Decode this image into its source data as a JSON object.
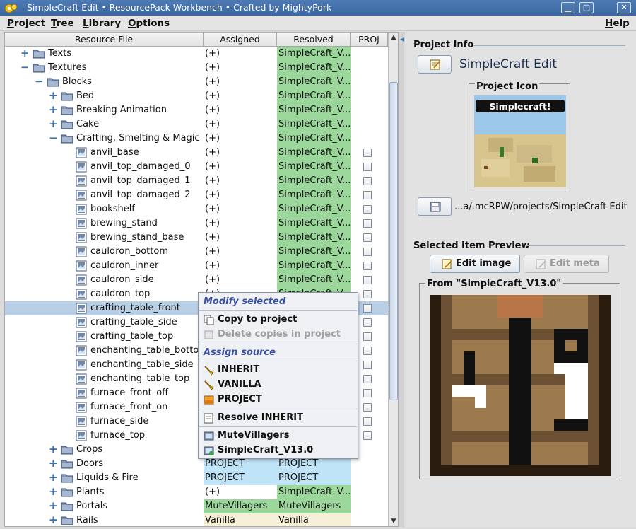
{
  "window": {
    "title": "SimpleCraft Edit  •  ResourcePack Workbench  •  Crafted by MightyPork",
    "buttons": {
      "minimize": "▁",
      "maximize": "▢",
      "close": "✕"
    }
  },
  "menubar": {
    "items": [
      {
        "key": "P",
        "rest": "roject"
      },
      {
        "key": "T",
        "rest": "ree"
      },
      {
        "key": "L",
        "rest": "ibrary"
      },
      {
        "key": "O",
        "rest": "ptions"
      }
    ],
    "help": {
      "key": "H",
      "rest": "elp"
    }
  },
  "table": {
    "headers": {
      "name": "Resource File",
      "assigned": "Assigned",
      "resolved": "Resolved",
      "proj": "PROJ"
    },
    "rows": [
      {
        "name": "Texts",
        "level": 1,
        "type": "folder",
        "exp": "+",
        "assigned": "(+)",
        "resolved": "SimpleCraft_V...",
        "resolved_bg": "green"
      },
      {
        "name": "Textures",
        "level": 1,
        "type": "folder",
        "exp": "−",
        "assigned": "(+)",
        "resolved": "SimpleCraft_V...",
        "resolved_bg": "green"
      },
      {
        "name": "Blocks",
        "level": 2,
        "type": "folder",
        "exp": "−",
        "assigned": "(+)",
        "resolved": "SimpleCraft_V...",
        "resolved_bg": "green"
      },
      {
        "name": "Bed",
        "level": 3,
        "type": "folder",
        "exp": "+",
        "assigned": "(+)",
        "resolved": "SimpleCraft_V...",
        "resolved_bg": "green"
      },
      {
        "name": "Breaking Animation",
        "level": 3,
        "type": "folder",
        "exp": "+",
        "assigned": "(+)",
        "resolved": "SimpleCraft_V...",
        "resolved_bg": "green"
      },
      {
        "name": "Cake",
        "level": 3,
        "type": "folder",
        "exp": "+",
        "assigned": "(+)",
        "resolved": "SimpleCraft_V...",
        "resolved_bg": "green"
      },
      {
        "name": "Crafting, Smelting & Magic",
        "level": 3,
        "type": "folder",
        "exp": "−",
        "assigned": "(+)",
        "resolved": "SimpleCraft_V...",
        "resolved_bg": "green"
      },
      {
        "name": "anvil_base",
        "level": 4,
        "type": "file",
        "assigned": "(+)",
        "resolved": "SimpleCraft_V...",
        "resolved_bg": "green",
        "check": true
      },
      {
        "name": "anvil_top_damaged_0",
        "level": 4,
        "type": "file",
        "assigned": "(+)",
        "resolved": "SimpleCraft_V...",
        "resolved_bg": "green",
        "check": true
      },
      {
        "name": "anvil_top_damaged_1",
        "level": 4,
        "type": "file",
        "assigned": "(+)",
        "resolved": "SimpleCraft_V...",
        "resolved_bg": "green",
        "check": true
      },
      {
        "name": "anvil_top_damaged_2",
        "level": 4,
        "type": "file",
        "assigned": "(+)",
        "resolved": "SimpleCraft_V...",
        "resolved_bg": "green",
        "check": true
      },
      {
        "name": "bookshelf",
        "level": 4,
        "type": "file",
        "assigned": "(+)",
        "resolved": "SimpleCraft_V...",
        "resolved_bg": "green",
        "check": true
      },
      {
        "name": "brewing_stand",
        "level": 4,
        "type": "file",
        "assigned": "(+)",
        "resolved": "SimpleCraft_V...",
        "resolved_bg": "green",
        "check": true
      },
      {
        "name": "brewing_stand_base",
        "level": 4,
        "type": "file",
        "assigned": "(+)",
        "resolved": "SimpleCraft_V...",
        "resolved_bg": "green",
        "check": true
      },
      {
        "name": "cauldron_bottom",
        "level": 4,
        "type": "file",
        "assigned": "(+)",
        "resolved": "SimpleCraft_V...",
        "resolved_bg": "green",
        "check": true
      },
      {
        "name": "cauldron_inner",
        "level": 4,
        "type": "file",
        "assigned": "(+)",
        "resolved": "SimpleCraft_V...",
        "resolved_bg": "green",
        "check": true
      },
      {
        "name": "cauldron_side",
        "level": 4,
        "type": "file",
        "assigned": "(+)",
        "resolved": "SimpleCraft_V...",
        "resolved_bg": "green",
        "check": true
      },
      {
        "name": "cauldron_top",
        "level": 4,
        "type": "file",
        "assigned": "(+)",
        "resolved": "SimpleCraft_V...",
        "resolved_bg": "green",
        "check": true
      },
      {
        "name": "crafting_table_front",
        "level": 4,
        "type": "file",
        "assigned": "",
        "resolved": "",
        "resolved_bg": "none",
        "check": true,
        "selected": true
      },
      {
        "name": "crafting_table_side",
        "level": 4,
        "type": "file",
        "assigned": "",
        "resolved": "",
        "resolved_bg": "none",
        "check": true
      },
      {
        "name": "crafting_table_top",
        "level": 4,
        "type": "file",
        "assigned": "",
        "resolved": "",
        "resolved_bg": "none",
        "check": true
      },
      {
        "name": "enchanting_table_bottom",
        "level": 4,
        "type": "file",
        "assigned": "",
        "resolved": "",
        "resolved_bg": "none",
        "check": true
      },
      {
        "name": "enchanting_table_side",
        "level": 4,
        "type": "file",
        "assigned": "",
        "resolved": "",
        "resolved_bg": "none",
        "check": true
      },
      {
        "name": "enchanting_table_top",
        "level": 4,
        "type": "file",
        "assigned": "",
        "resolved": "",
        "resolved_bg": "none",
        "check": true
      },
      {
        "name": "furnace_front_off",
        "level": 4,
        "type": "file",
        "assigned": "",
        "resolved": "",
        "resolved_bg": "none",
        "check": true
      },
      {
        "name": "furnace_front_on",
        "level": 4,
        "type": "file",
        "assigned": "",
        "resolved": "",
        "resolved_bg": "none",
        "check": true
      },
      {
        "name": "furnace_side",
        "level": 4,
        "type": "file",
        "assigned": "",
        "resolved": "",
        "resolved_bg": "none",
        "check": true
      },
      {
        "name": "furnace_top",
        "level": 4,
        "type": "file",
        "assigned": "",
        "resolved": "",
        "resolved_bg": "none",
        "check": true
      },
      {
        "name": "Crops",
        "level": 3,
        "type": "folder",
        "exp": "+",
        "assigned": "",
        "resolved": "",
        "resolved_bg": "none"
      },
      {
        "name": "Doors",
        "level": 3,
        "type": "folder",
        "exp": "+",
        "assigned": "PROJECT",
        "assigned_bg": "blue",
        "resolved": "PROJECT",
        "resolved_bg": "blue"
      },
      {
        "name": "Liquids & Fire",
        "level": 3,
        "type": "folder",
        "exp": "+",
        "assigned": "PROJECT",
        "assigned_bg": "blue",
        "resolved": "PROJECT",
        "resolved_bg": "blue"
      },
      {
        "name": "Plants",
        "level": 3,
        "type": "folder",
        "exp": "+",
        "assigned": "(+)",
        "resolved": "SimpleCraft_V...",
        "resolved_bg": "green"
      },
      {
        "name": "Portals",
        "level": 3,
        "type": "folder",
        "exp": "+",
        "assigned": "MuteVillagers",
        "assigned_bg": "green",
        "resolved": "MuteVillagers",
        "resolved_bg": "green"
      },
      {
        "name": "Rails",
        "level": 3,
        "type": "folder",
        "exp": "+",
        "assigned": "Vanilla",
        "assigned_bg": "cream",
        "resolved": "Vanilla",
        "resolved_bg": "cream"
      }
    ]
  },
  "context_menu": {
    "head_modify": "Modify selected",
    "copy": "Copy to project",
    "delete": "Delete copies in project",
    "head_assign": "Assign source",
    "inherit": "INHERIT",
    "vanilla": "VANILLA",
    "project": "PROJECT",
    "resolve": "Resolve INHERIT",
    "pack1": "MuteVillagers",
    "pack2": "SimpleCraft_V13.0"
  },
  "right": {
    "project_info_title": "Project Info",
    "project_name": "SimpleCraft Edit",
    "project_icon_title": "Project Icon",
    "icon_banner": "Simplecraft!",
    "path": "...a/.mcRPW/projects/SimpleCraft Edit",
    "preview_title": "Selected Item Preview",
    "edit_image": "Edit image",
    "edit_meta": "Edit meta",
    "from_label": "From \"SimpleCraft_V13.0\""
  },
  "colors": {
    "green": "#9bd79b",
    "blue": "#bfe3f7",
    "cream": "#f6f0d8",
    "selection": "#b8cfe5",
    "titlebar": "#3b67a3"
  }
}
